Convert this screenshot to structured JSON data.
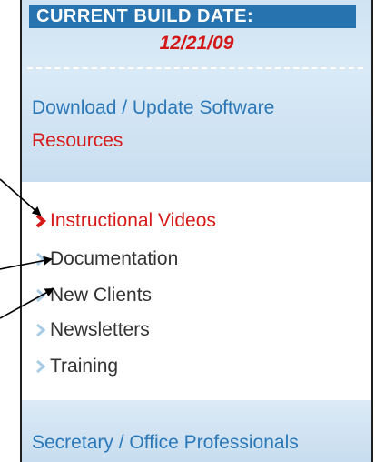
{
  "build": {
    "title": "CURRENT BUILD DATE:",
    "date": "12/21/09"
  },
  "menu": {
    "download_link": "Download / Update Software",
    "resources_link": "Resources",
    "sub_items": [
      {
        "label": "Instructional Videos",
        "active": true
      },
      {
        "label": "Documentation",
        "active": false
      },
      {
        "label": "New Clients",
        "active": false
      },
      {
        "label": "Newsletters",
        "active": false
      },
      {
        "label": "Training",
        "active": false
      }
    ],
    "secretary_link": "Secretary / Office Professionals"
  },
  "colors": {
    "header_bar": "#2673b0",
    "date_red": "#d41717",
    "link_blue": "#2b78b8",
    "active_red": "#d61a1a",
    "chevron_inactive": "#a9cce6"
  },
  "annotations": {
    "arrow_count": 3
  }
}
